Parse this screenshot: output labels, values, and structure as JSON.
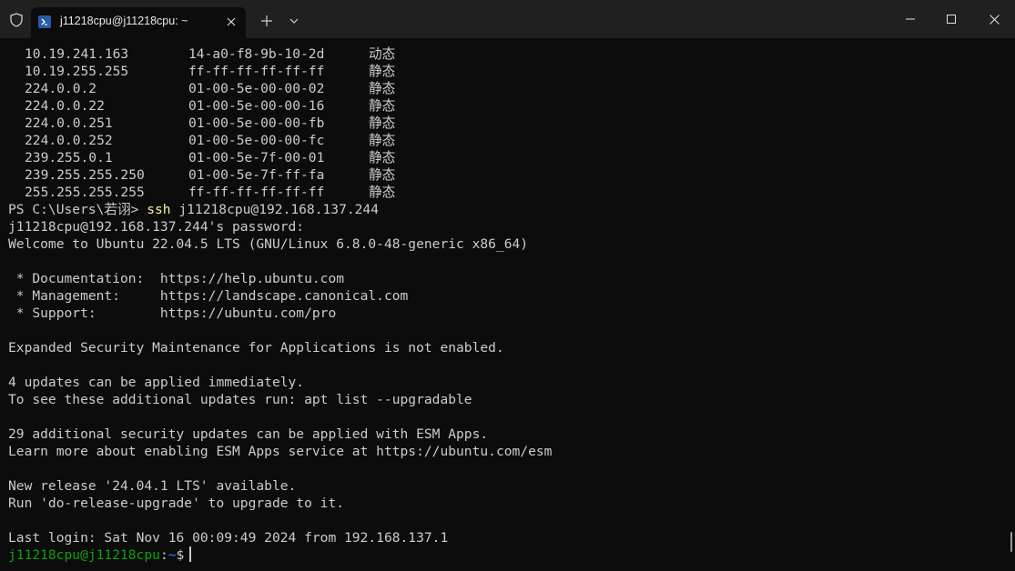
{
  "tab": {
    "title": "j11218cpu@j11218cpu: ~"
  },
  "arp_entries": [
    {
      "ip": "10.19.241.163",
      "mac": "14-a0-f8-9b-10-2d",
      "type": "动态"
    },
    {
      "ip": "10.19.255.255",
      "mac": "ff-ff-ff-ff-ff-ff",
      "type": "静态"
    },
    {
      "ip": "224.0.0.2",
      "mac": "01-00-5e-00-00-02",
      "type": "静态"
    },
    {
      "ip": "224.0.0.22",
      "mac": "01-00-5e-00-00-16",
      "type": "静态"
    },
    {
      "ip": "224.0.0.251",
      "mac": "01-00-5e-00-00-fb",
      "type": "静态"
    },
    {
      "ip": "224.0.0.252",
      "mac": "01-00-5e-00-00-fc",
      "type": "静态"
    },
    {
      "ip": "239.255.0.1",
      "mac": "01-00-5e-7f-00-01",
      "type": "静态"
    },
    {
      "ip": "239.255.255.250",
      "mac": "01-00-5e-7f-ff-fa",
      "type": "静态"
    },
    {
      "ip": "255.255.255.255",
      "mac": "ff-ff-ff-ff-ff-ff",
      "type": "静态"
    }
  ],
  "ps_prompt": "PS C:\\Users\\若诩> ",
  "ssh_keyword": "ssh",
  "ssh_args": " j11218cpu@192.168.137.244",
  "output_lines": [
    "j11218cpu@192.168.137.244's password:",
    "Welcome to Ubuntu 22.04.5 LTS (GNU/Linux 6.8.0-48-generic x86_64)",
    "",
    " * Documentation:  https://help.ubuntu.com",
    " * Management:     https://landscape.canonical.com",
    " * Support:        https://ubuntu.com/pro",
    "",
    "Expanded Security Maintenance for Applications is not enabled.",
    "",
    "4 updates can be applied immediately.",
    "To see these additional updates run: apt list --upgradable",
    "",
    "29 additional security updates can be applied with ESM Apps.",
    "Learn more about enabling ESM Apps service at https://ubuntu.com/esm",
    "",
    "New release '24.04.1 LTS' available.",
    "Run 'do-release-upgrade' to upgrade to it.",
    "",
    "Last login: Sat Nov 16 00:09:49 2024 from 192.168.137.1"
  ],
  "final_prompt": {
    "user_host": "j11218cpu@j11218cpu",
    "sep": ":",
    "path": "~",
    "symbol": "$"
  },
  "colors": {
    "background": "#0c0c0c",
    "titlebar": "#202020",
    "text": "#cccccc",
    "ssh_command": "#f9f1a5",
    "prompt_user": "#13a10e",
    "prompt_path": "#3b78ff"
  }
}
